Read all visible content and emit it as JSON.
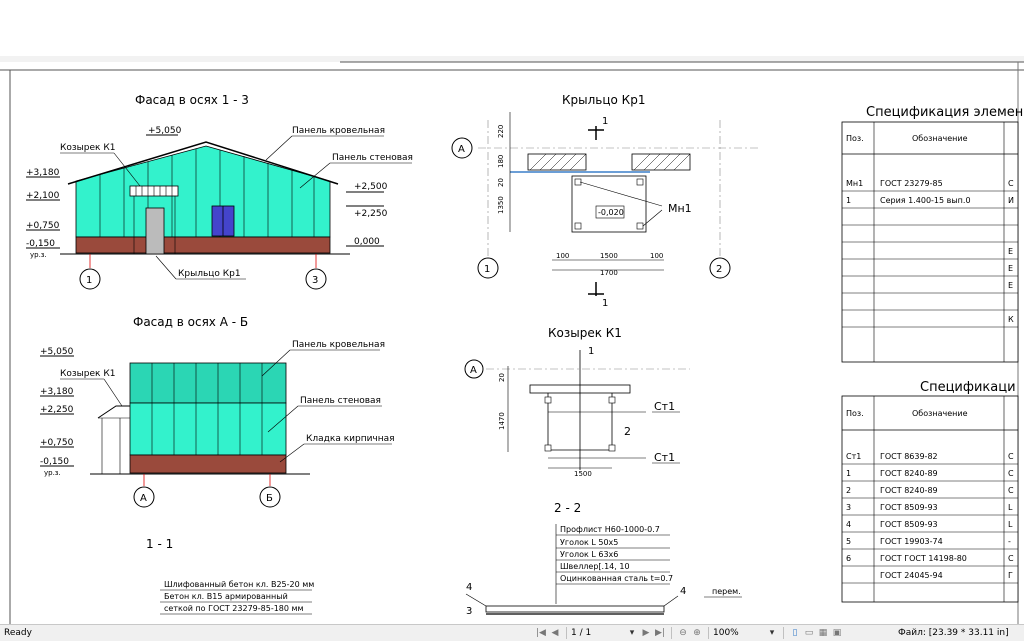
{
  "drawing": {
    "facade1": {
      "title": "Фасад в осях 1 - 3",
      "levels": [
        "+5,050",
        "+3,180",
        "+2,100",
        "+0,750",
        "-0,150",
        "ур.з.",
        "+2,500",
        "+2,250",
        "0,000"
      ],
      "labels": {
        "roof": "Панель кровельная",
        "wall": "Панель стеновая",
        "canopy": "Козырек К1",
        "porch": "Крыльцо Кр1"
      },
      "axes": [
        "1",
        "3"
      ]
    },
    "facade2": {
      "title": "Фасад в осях А - Б",
      "levels": [
        "+5,050",
        "+3,180",
        "+2,250",
        "+0,750",
        "-0,150",
        "ур.з."
      ],
      "labels": {
        "roof": "Панель кровельная",
        "wall": "Панель стеновая",
        "canopy": "Козырек К1",
        "brick": "Кладка кирпичная"
      },
      "axes": [
        "А",
        "Б"
      ]
    },
    "section11": {
      "title": "1 - 1"
    },
    "layers11": [
      "Шлифованный бетон кл. В25-20 мм",
      "Бетон кл. В15 армированный",
      "сеткой по ГОСТ 23279-85-180 мм"
    ],
    "porch": {
      "title": "Крыльцо Кр1",
      "axis_a": "А",
      "axes": [
        "1",
        "2"
      ],
      "cut": "1",
      "dims_v": [
        "220",
        "180",
        "20",
        "1350"
      ],
      "dims_h": [
        "100",
        "1500",
        "100",
        "1700"
      ],
      "level": "-0,020",
      "mark": "Мн1"
    },
    "canopy": {
      "title": "Козырек К1",
      "axis": "А",
      "cut_top": "1",
      "cut_mid": "2",
      "dims_v": [
        "20",
        "1470"
      ],
      "dim_h": "1500",
      "marks": [
        "Ст1",
        "Ст1"
      ]
    },
    "section22": {
      "title": "2 - 2",
      "layers": [
        "Профлист Н60-1000-0.7",
        "Уголок L 50х5",
        "Уголок L 63х6",
        "Швеллер[.14, 10",
        "Оцинкованная сталь t=0.7"
      ],
      "marks": [
        "4",
        "3",
        "4"
      ],
      "note": "перем."
    },
    "spec1": {
      "title": "Спецификация элемен",
      "headers": [
        "Поз.",
        "Обозначение"
      ],
      "rows": [
        {
          "pos": "Мн1",
          "code": "ГОСТ 23279-85",
          "tail": "С"
        },
        {
          "pos": "1",
          "code": "Серия 1.400-15 вып.0",
          "tail": "И"
        },
        {
          "pos": "",
          "code": "",
          "tail": ""
        },
        {
          "pos": "",
          "code": "",
          "tail": ""
        },
        {
          "pos": "",
          "code": "",
          "tail": "Е"
        },
        {
          "pos": "",
          "code": "",
          "tail": "Е"
        },
        {
          "pos": "",
          "code": "",
          "tail": "Е"
        },
        {
          "pos": "",
          "code": "",
          "tail": ""
        },
        {
          "pos": "",
          "code": "",
          "tail": "К"
        }
      ]
    },
    "spec2": {
      "title": "Спецификаци",
      "headers": [
        "Поз.",
        "Обозначение"
      ],
      "rows": [
        {
          "pos": "Ст1",
          "code": "ГОСТ 8639-82",
          "tail": "С"
        },
        {
          "pos": "1",
          "code": "ГОСТ 8240-89",
          "tail": "С"
        },
        {
          "pos": "2",
          "code": "ГОСТ 8240-89",
          "tail": "С"
        },
        {
          "pos": "3",
          "code": "ГОСТ 8509-93",
          "tail": "L"
        },
        {
          "pos": "4",
          "code": "ГОСТ 8509-93",
          "tail": "L"
        },
        {
          "pos": "5",
          "code": "ГОСТ 19903-74",
          "tail": "-"
        },
        {
          "pos": "6",
          "code": "ГОСТ ГОСТ 14198-80",
          "tail": "С"
        },
        {
          "pos": "",
          "code": "ГОСТ 24045-94",
          "tail": "Г"
        }
      ]
    }
  },
  "statusbar": {
    "ready": "Ready",
    "page": "1 / 1",
    "zoom": "100%",
    "file": "Файл: [23.39 * 33.11 in]"
  },
  "colors": {
    "panel": "#33f2cc",
    "panel_dark": "#1ec9a8",
    "brick": "#9a4a3c",
    "ground": "#e0c8b0"
  }
}
